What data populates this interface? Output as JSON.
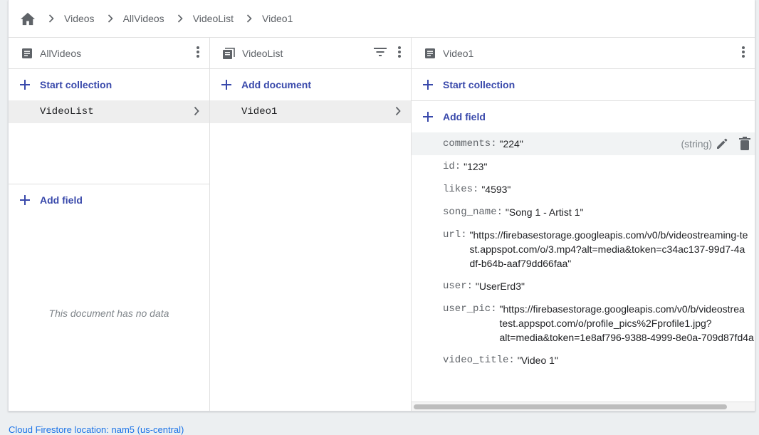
{
  "breadcrumb": {
    "items": [
      "Videos",
      "AllVideos",
      "VideoList",
      "Video1"
    ]
  },
  "panels": {
    "col1": {
      "title": "AllVideos",
      "action": "Start collection",
      "items": [
        "VideoList"
      ],
      "add_field": "Add field",
      "empty_text": "This document has no data"
    },
    "col2": {
      "title": "VideoList",
      "action": "Add document",
      "items": [
        "Video1"
      ]
    },
    "col3": {
      "title": "Video1",
      "start_collection": "Start collection",
      "add_field": "Add field",
      "fields": [
        {
          "key": "comments:",
          "value": "\"224\"",
          "type": "(string)"
        },
        {
          "key": "id:",
          "value": "\"123\""
        },
        {
          "key": "likes:",
          "value": "\"4593\""
        },
        {
          "key": "song_name:",
          "value": "\"Song 1 - Artist 1\""
        },
        {
          "key": "url:",
          "value": "\"https://firebasestorage.googleapis.com/v0/b/videostreaming-test.appspot.com/o/3.mp4?alt=media&token=c34ac137-99d7-4adf-b64b-aaf79dd66faa\""
        },
        {
          "key": "user:",
          "value": "\"UserErd3\""
        },
        {
          "key": "user_pic:",
          "value_lines": [
            "\"https://firebasestorage.googleapis.com/v0/b/videostrea",
            "test.appspot.com/o/profile_pics%2Fprofile1.jpg?",
            "alt=media&token=1e8af796-9388-4999-8e0a-709d87fd4a"
          ]
        },
        {
          "key": "video_title:",
          "value": "\"Video 1\""
        }
      ]
    }
  },
  "footer": {
    "location": "Cloud Firestore location: nam5 (us-central)"
  },
  "colors": {
    "accent": "#3949ab",
    "link": "#1a73e8",
    "selected_row": "#eeeeee"
  }
}
